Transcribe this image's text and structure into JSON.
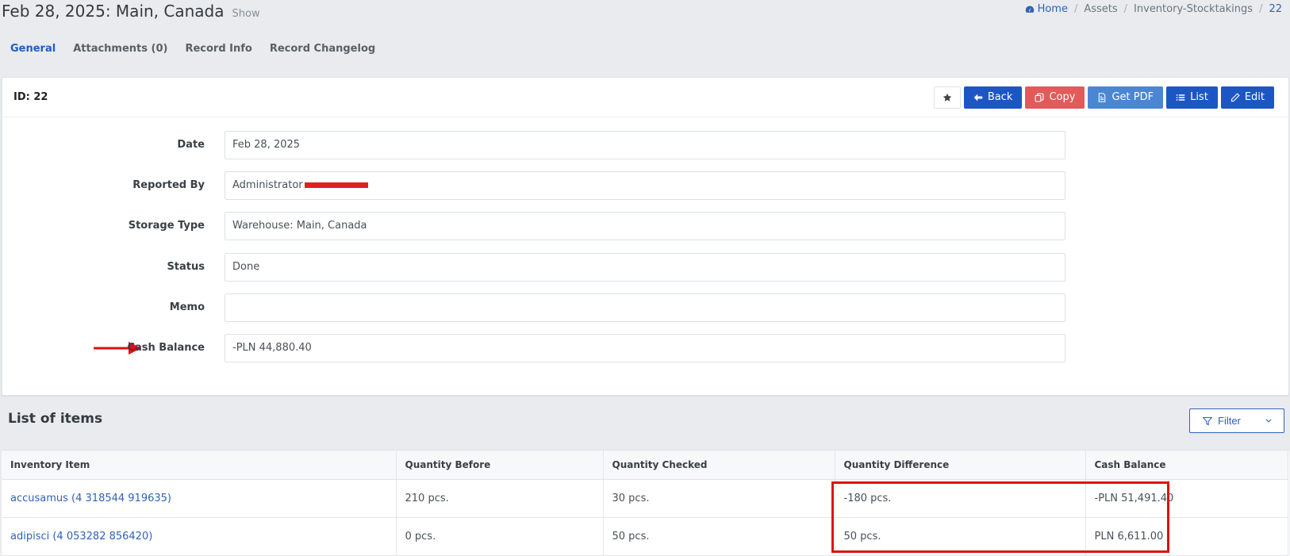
{
  "header": {
    "title": "Feb 28, 2025: Main, Canada",
    "subtitle": "Show"
  },
  "breadcrumb": {
    "home": "Home",
    "assets": "Assets",
    "section": "Inventory-Stocktakings",
    "id": "22"
  },
  "tabs": [
    "General",
    "Attachments (0)",
    "Record Info",
    "Record Changelog"
  ],
  "card": {
    "title": "ID: 22",
    "buttons": {
      "back": "Back",
      "copy": "Copy",
      "pdf": "Get PDF",
      "list": "List",
      "edit": "Edit"
    }
  },
  "form": {
    "date": {
      "label": "Date",
      "value": "Feb 28, 2025"
    },
    "reported_by": {
      "label": "Reported By",
      "value": "Administrator"
    },
    "storage_type": {
      "label": "Storage Type",
      "value": "Warehouse: Main, Canada"
    },
    "status": {
      "label": "Status",
      "value": "Done"
    },
    "memo": {
      "label": "Memo",
      "value": ""
    },
    "cash_balance": {
      "label": "Cash Balance",
      "value": "-PLN 44,880.40"
    }
  },
  "items": {
    "title": "List of items",
    "filter_label": "Filter",
    "columns": [
      "Inventory Item",
      "Quantity Before",
      "Quantity Checked",
      "Quantity Difference",
      "Cash Balance"
    ],
    "rows": [
      {
        "item": "accusamus (4 318544 919635)",
        "before": "210 pcs.",
        "checked": "30 pcs.",
        "difference": "-180 pcs.",
        "cash": "-PLN 51,491.40"
      },
      {
        "item": "adipisci (4 053282 856420)",
        "before": "0 pcs.",
        "checked": "50 pcs.",
        "difference": "50 pcs.",
        "cash": "PLN 6,611.00"
      }
    ]
  },
  "colors": {
    "primary": "#1b56c4",
    "danger": "#e25a5a",
    "info": "#4a86d4",
    "link": "#2e62b8",
    "annotation": "#e01010"
  }
}
